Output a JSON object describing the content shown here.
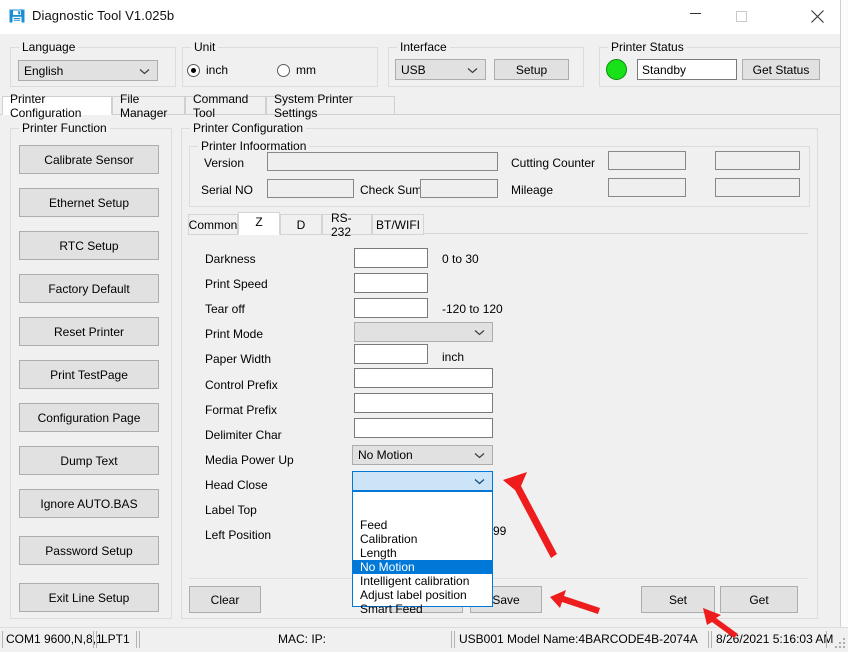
{
  "window": {
    "title": "Diagnostic Tool V1.025b",
    "icon": "floppy-disk-icon",
    "minimize_label": "Minimize",
    "maximize_label": "Maximize",
    "close_label": "Close"
  },
  "toolbar": {
    "language": {
      "legend": "Language",
      "value": "English"
    },
    "unit": {
      "legend": "Unit",
      "inch_label": "inch",
      "mm_label": "mm",
      "selected": "inch"
    },
    "interface": {
      "legend": "Interface",
      "value": "USB",
      "setup_label": "Setup"
    },
    "printer_status": {
      "legend": "Printer  Status",
      "led_color": "#18e118",
      "status_value": "Standby",
      "get_status_label": "Get Status"
    }
  },
  "main_tabs": {
    "selected": "Printer Configuration",
    "items": [
      {
        "label": "Printer Configuration"
      },
      {
        "label": "File Manager"
      },
      {
        "label": "Command Tool"
      },
      {
        "label": "System Printer Settings"
      }
    ]
  },
  "printer_function": {
    "legend": "Printer  Function",
    "buttons": [
      {
        "label": "Calibrate Sensor"
      },
      {
        "label": "Ethernet Setup"
      },
      {
        "label": "RTC Setup"
      },
      {
        "label": "Factory Default"
      },
      {
        "label": "Reset Printer"
      },
      {
        "label": "Print TestPage"
      },
      {
        "label": "Configuration Page"
      },
      {
        "label": "Dump Text"
      },
      {
        "label": "Ignore AUTO.BAS"
      },
      {
        "label": "Password Setup"
      },
      {
        "label": "Exit Line Setup"
      }
    ]
  },
  "printer_configuration": {
    "legend": "Printer Configuration",
    "information": {
      "legend": "Printer Infoormation",
      "version_label": "Version",
      "version_value": "",
      "serial_no_label": "Serial NO",
      "serial_no_value": "",
      "check_sum_label": "Check Sum",
      "check_sum_value": "",
      "cutting_counter_label": "Cutting Counter",
      "cutting_counter_value": "",
      "cutting_counter_value2": "",
      "mileage_label": "Mileage",
      "mileage_value": "",
      "mileage_value2": ""
    },
    "inner_tabs": {
      "selected": "Z",
      "items": [
        {
          "label": "Common"
        },
        {
          "label": "Z"
        },
        {
          "label": "D"
        },
        {
          "label": "RS-232"
        },
        {
          "label": "BT/WIFI"
        }
      ]
    },
    "fields": [
      {
        "label": "Darkness",
        "value": "",
        "hint": "0 to 30"
      },
      {
        "label": "Print Speed",
        "value": "",
        "hint": ""
      },
      {
        "label": "Tear  off",
        "value": "",
        "hint": "-120 to 120"
      },
      {
        "label": "Print Mode",
        "value": "",
        "hint": ""
      },
      {
        "label": "Paper Width",
        "value": "",
        "hint": "inch"
      },
      {
        "label": "Control Prefix",
        "value": "",
        "hint": ""
      },
      {
        "label": "Format Prefix",
        "value": "",
        "hint": ""
      },
      {
        "label": "Delimiter Char",
        "value": "",
        "hint": ""
      },
      {
        "label": "Media Power Up",
        "value": "No Motion",
        "hint": ""
      },
      {
        "label": "Head Close",
        "value": "",
        "hint": ""
      },
      {
        "label": "Label Top",
        "value": "",
        "hint": ""
      },
      {
        "label": "Left Position",
        "value": "",
        "hint": "99"
      }
    ],
    "head_close_dropdown": {
      "open": true,
      "options": [
        {
          "label": ""
        },
        {
          "label": "Feed"
        },
        {
          "label": "Calibration"
        },
        {
          "label": "Length"
        },
        {
          "label": "No Motion"
        },
        {
          "label": "Intelligent calibration"
        },
        {
          "label": "Adjust label position"
        },
        {
          "label": "Smart Feed"
        }
      ],
      "selected": "No Motion"
    },
    "action_buttons": {
      "clear_label": "Clear",
      "hidden_label": "",
      "save_label": "Save",
      "set_label": "Set",
      "get_label": "Get"
    }
  },
  "status_bar": {
    "com_port": "COM1 9600,N,8,1",
    "lpt_port": "LPT1",
    "mac_ip": "MAC: IP:",
    "usb": "USB001  Model Name:4BARCODE4B-2074A",
    "datetime": "8/26/2021 5:16:03 AM"
  },
  "annotations": {
    "arrow_color": "#ee1c1c",
    "arrows": [
      {
        "name": "arrow-head-close-combo"
      },
      {
        "name": "arrow-save-button"
      },
      {
        "name": "arrow-set-button"
      }
    ]
  }
}
